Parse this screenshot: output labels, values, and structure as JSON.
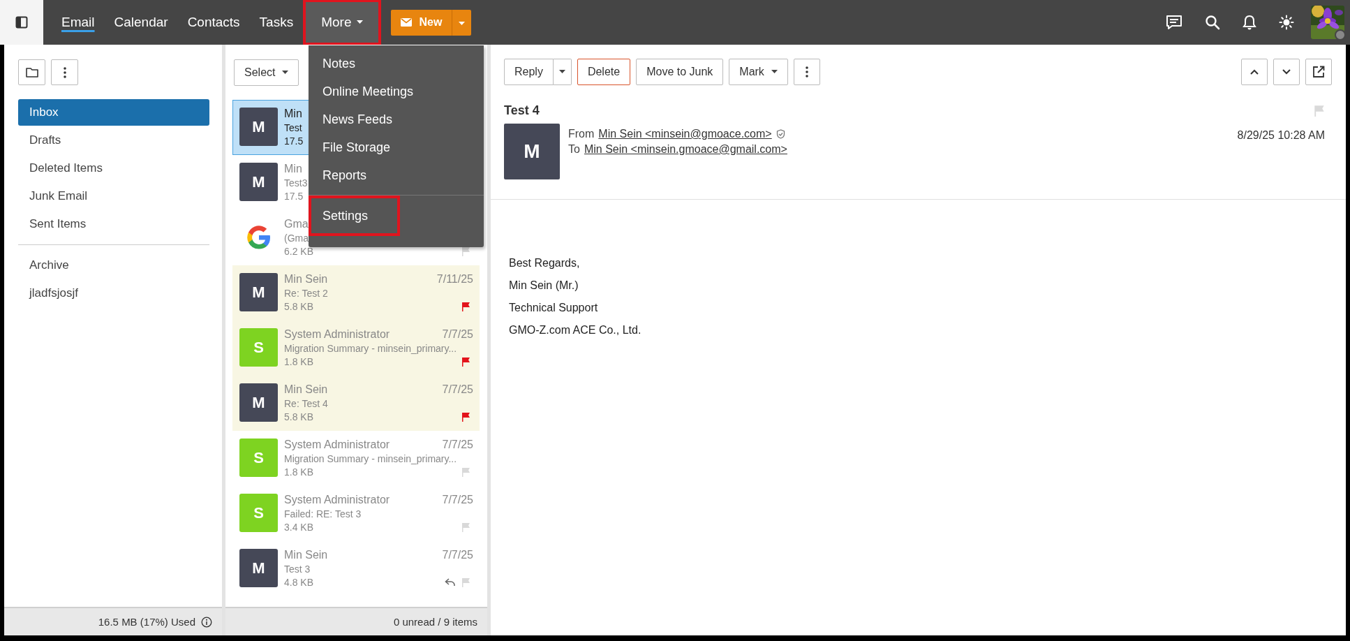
{
  "top_bar": {
    "tabs": [
      {
        "label": "Email",
        "selected": true,
        "highlighted": false,
        "dropdown": false
      },
      {
        "label": "Calendar",
        "selected": false,
        "highlighted": false,
        "dropdown": false
      },
      {
        "label": "Contacts",
        "selected": false,
        "highlighted": false,
        "dropdown": false
      },
      {
        "label": "Tasks",
        "selected": false,
        "highlighted": false,
        "dropdown": false
      },
      {
        "label": "More",
        "selected": false,
        "highlighted": true,
        "dropdown": true
      }
    ],
    "new_button": "New"
  },
  "more_menu": {
    "items": [
      {
        "label": "Notes",
        "separated": false,
        "highlighted": false
      },
      {
        "label": "Online Meetings",
        "separated": false,
        "highlighted": false
      },
      {
        "label": "News Feeds",
        "separated": false,
        "highlighted": false
      },
      {
        "label": "File Storage",
        "separated": false,
        "highlighted": false
      },
      {
        "label": "Reports",
        "separated": false,
        "highlighted": false
      },
      {
        "label": "Settings",
        "separated": true,
        "highlighted": true
      }
    ]
  },
  "folders": {
    "groups": [
      [
        {
          "label": "Inbox",
          "selected": true
        },
        {
          "label": "Drafts",
          "selected": false
        },
        {
          "label": "Deleted Items",
          "selected": false
        },
        {
          "label": "Junk Email",
          "selected": false
        },
        {
          "label": "Sent Items",
          "selected": false
        }
      ],
      [
        {
          "label": "Archive",
          "selected": false
        },
        {
          "label": "jladfsjosjf",
          "selected": false
        }
      ]
    ],
    "storage": "16.5 MB (17%) Used"
  },
  "message_list": {
    "select_label": "Select",
    "status": "0 unread / 9 items",
    "messages": [
      {
        "avatar": {
          "kind": "letter",
          "initial": "M",
          "color": "#454857"
        },
        "sender": "Min",
        "subject": "Test",
        "size": "17.5",
        "selected": true,
        "replied": false
      },
      {
        "avatar": {
          "kind": "letter",
          "initial": "M",
          "color": "#454857"
        },
        "sender": "Min",
        "subject": "Test3",
        "size": "17.5",
        "selected": false,
        "replied": false
      },
      {
        "avatar": {
          "kind": "google"
        },
        "sender": "Gma",
        "subject": "(Gma",
        "size": "6.2 KB",
        "selected": false,
        "flagged": false,
        "replied": false
      },
      {
        "avatar": {
          "kind": "letter",
          "initial": "M",
          "color": "#454857"
        },
        "sender": "Min Sein",
        "date": "7/11/25",
        "subject": "Re: Test 2",
        "size": "5.8 KB",
        "selected": false,
        "flagged": true,
        "replied": false
      },
      {
        "avatar": {
          "kind": "letter",
          "initial": "S",
          "color": "#7ed321"
        },
        "sender": "System Administrator",
        "date": "7/7/25",
        "subject": "Migration Summary - minsein_primary...",
        "size": "1.8 KB",
        "selected": false,
        "flagged": true,
        "replied": false
      },
      {
        "avatar": {
          "kind": "letter",
          "initial": "M",
          "color": "#454857"
        },
        "sender": "Min Sein",
        "date": "7/7/25",
        "subject": "Re: Test 4",
        "size": "5.8 KB",
        "selected": false,
        "flagged": true,
        "replied": false
      },
      {
        "avatar": {
          "kind": "letter",
          "initial": "S",
          "color": "#7ed321"
        },
        "sender": "System Administrator",
        "date": "7/7/25",
        "subject": "Migration Summary - minsein_primary...",
        "size": "1.8 KB",
        "selected": false,
        "flagged": false,
        "replied": false
      },
      {
        "avatar": {
          "kind": "letter",
          "initial": "S",
          "color": "#7ed321"
        },
        "sender": "System Administrator",
        "date": "7/7/25",
        "subject": "Failed: RE: Test 3",
        "size": "3.4 KB",
        "selected": false,
        "flagged": false,
        "replied": false
      },
      {
        "avatar": {
          "kind": "letter",
          "initial": "M",
          "color": "#454857"
        },
        "sender": "Min Sein",
        "date": "7/7/25",
        "subject": "Test 3",
        "size": "4.8 KB",
        "selected": false,
        "flagged": false,
        "replied": true
      }
    ]
  },
  "reading_pane": {
    "toolbar": {
      "reply": "Reply",
      "delete": "Delete",
      "junk": "Move to Junk",
      "mark": "Mark"
    },
    "subject": "Test 4",
    "flagged": false,
    "avatar_initial": "M",
    "from_label": "From",
    "from": "Min Sein <minsein@gmoace.com>",
    "to_label": "To",
    "to": "Min Sein <minsein.gmoace@gmail.com>",
    "date": "8/29/25 10:28 AM",
    "body": [
      "Best Regards,",
      "Min Sein (Mr.)",
      "Technical Support",
      "GMO-Z.com ACE Co., Ltd."
    ]
  }
}
